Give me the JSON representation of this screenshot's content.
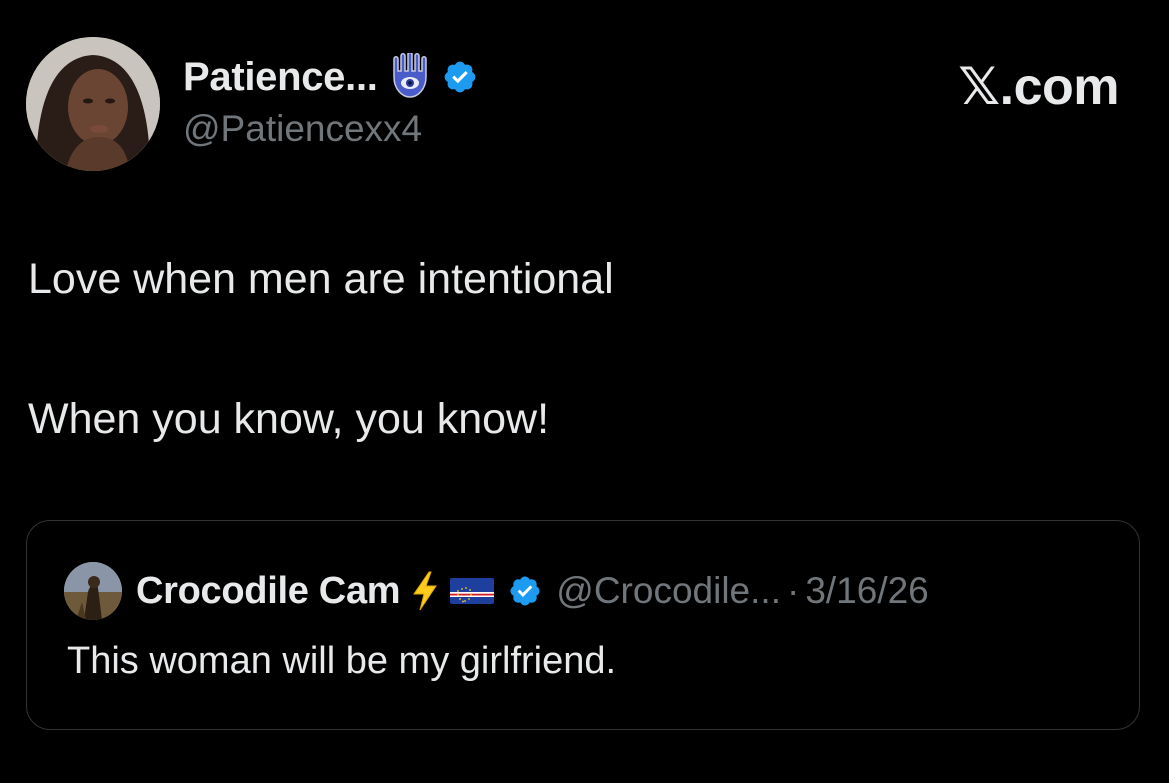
{
  "tweet": {
    "author": {
      "display_name": "Patience...",
      "handle": "@Patiencexx4",
      "verified": true,
      "name_emoji": "hamsa-icon"
    },
    "brand": "𝕏.com",
    "text_line1": "Love when men are intentional",
    "text_line2": "When you know, you know!"
  },
  "quote": {
    "author": {
      "display_name": "Crocodile Cam",
      "name_emojis": [
        "bolt-icon",
        "cape-verde-flag-icon"
      ],
      "verified": true,
      "handle": "@Crocodile...",
      "separator": "·",
      "date": "3/16/26"
    },
    "text": "This woman will be my girlfriend."
  },
  "colors": {
    "background": "#000000",
    "text_primary": "#e7e9ea",
    "text_secondary": "#71767b",
    "verified_blue": "#1d9bf0",
    "border": "#2f3336"
  }
}
